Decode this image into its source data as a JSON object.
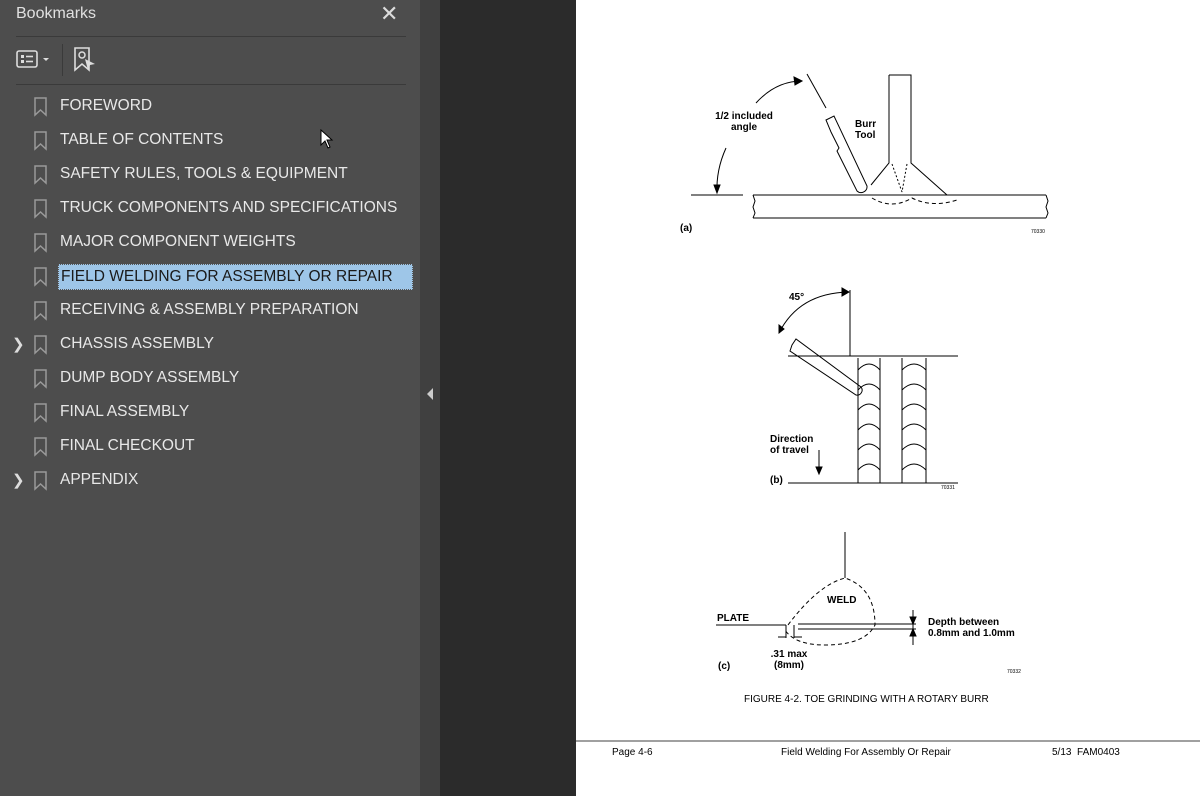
{
  "sidebar": {
    "title": "Bookmarks",
    "close_icon": "close-icon",
    "tools": [
      "options-list-icon",
      "find-bookmark-icon"
    ],
    "items": [
      {
        "label": "FOREWORD",
        "expandable": false
      },
      {
        "label": "TABLE OF CONTENTS",
        "expandable": false
      },
      {
        "label": "SAFETY RULES, TOOLS & EQUIPMENT",
        "expandable": false
      },
      {
        "label": "TRUCK COMPONENTS AND SPECIFICATIONS",
        "expandable": false
      },
      {
        "label": "MAJOR COMPONENT WEIGHTS",
        "expandable": false
      },
      {
        "label": "FIELD WELDING FOR ASSEMBLY OR REPAIR",
        "expandable": false,
        "selected": true
      },
      {
        "label": "RECEIVING & ASSEMBLY PREPARATION",
        "expandable": false
      },
      {
        "label": "CHASSIS ASSEMBLY",
        "expandable": true
      },
      {
        "label": "DUMP BODY ASSEMBLY",
        "expandable": false
      },
      {
        "label": "FINAL ASSEMBLY",
        "expandable": false
      },
      {
        "label": "FINAL CHECKOUT",
        "expandable": false
      },
      {
        "label": "APPENDIX",
        "expandable": true
      }
    ]
  },
  "page": {
    "fig_a": {
      "angle": "1/2 included angle",
      "tool": "Burr Tool",
      "tag": "(a)",
      "code": "70330"
    },
    "fig_b": {
      "angle": "45°",
      "direction": "Direction of travel",
      "tag": "(b)",
      "code": "70331"
    },
    "fig_c": {
      "weld": "WELD",
      "plate": "PLATE",
      "depth": "Depth between 0.8mm and 1.0mm",
      "max": ".31 max (8mm)",
      "tag": "(c)",
      "code": "70332"
    },
    "caption": "FIGURE 4-2. TOE GRINDING WITH A ROTARY BURR",
    "footer": {
      "page": "Page 4-6",
      "section": "Field Welding For Assembly Or Repair",
      "code": "5/13  FAM0403"
    }
  }
}
